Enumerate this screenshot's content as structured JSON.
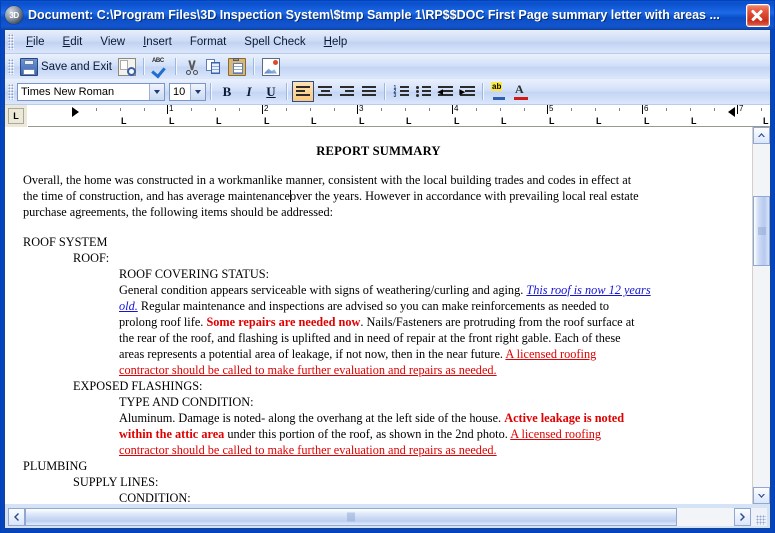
{
  "window": {
    "title": "Document: C:\\Program Files\\3D Inspection System\\$tmp Sample 1\\RP$$DOC First Page summary letter with areas ...",
    "icon": "3d-sphere-icon",
    "close_label": "✕"
  },
  "menubar": {
    "items": [
      {
        "label": "File",
        "accel": "F"
      },
      {
        "label": "Edit",
        "accel": "E"
      },
      {
        "label": "View",
        "accel": "V"
      },
      {
        "label": "Insert",
        "accel": "I"
      },
      {
        "label": "Format",
        "accel": "o"
      },
      {
        "label": "Spell Check",
        "accel": "S"
      },
      {
        "label": "Help",
        "accel": "H"
      }
    ]
  },
  "toolbar": {
    "save_and_exit_label": "Save and Exit",
    "buttons": [
      {
        "name": "save-and-exit",
        "icon": "floppy-disk-icon"
      },
      {
        "name": "print-preview",
        "icon": "print-preview-icon"
      },
      {
        "name": "spell-check",
        "icon": "abc-checkmark-icon"
      },
      {
        "name": "cut",
        "icon": "scissors-icon"
      },
      {
        "name": "copy",
        "icon": "copy-icon"
      },
      {
        "name": "paste",
        "icon": "clipboard-icon"
      },
      {
        "name": "insert-image",
        "icon": "picture-icon"
      }
    ]
  },
  "format_toolbar": {
    "font_name": "Times New Roman",
    "font_size": "10",
    "bold_label": "B",
    "italic_label": "I",
    "underline_label": "U",
    "buttons": [
      {
        "name": "align-left",
        "icon": "align-left-icon",
        "active": true
      },
      {
        "name": "align-center",
        "icon": "align-center-icon",
        "active": false
      },
      {
        "name": "align-right",
        "icon": "align-right-icon",
        "active": false
      },
      {
        "name": "align-justify",
        "icon": "align-justify-icon",
        "active": false
      },
      {
        "name": "numbered-list",
        "icon": "numbered-list-icon",
        "active": false
      },
      {
        "name": "bulleted-list",
        "icon": "bulleted-list-icon",
        "active": false
      },
      {
        "name": "decrease-indent",
        "icon": "decrease-indent-icon",
        "active": false
      },
      {
        "name": "increase-indent",
        "icon": "increase-indent-icon",
        "active": false
      },
      {
        "name": "highlight",
        "icon": "highlight-icon",
        "active": false
      },
      {
        "name": "font-color",
        "icon": "font-color-icon",
        "active": false
      }
    ]
  },
  "ruler": {
    "tab_selector": "L",
    "numbers": [
      "1",
      "2",
      "3",
      "4",
      "5",
      "6",
      "7"
    ],
    "unit": "inches"
  },
  "document": {
    "title": "REPORT SUMMARY",
    "paragraph_1a": "Overall, the home was constructed in a workmanlike manner, consistent with the local building trades and codes in effect at",
    "paragraph_1b": "the time of construction, and has average maintenance",
    "paragraph_1c": "over the years.  However in accordance with  prevailing local real estate",
    "paragraph_1d": "purchase agreements, the following items should be addressed:",
    "heading_roof_system": "ROOF SYSTEM",
    "heading_roof": "ROOF:",
    "heading_roof_covering_status": "ROOF COVERING STATUS:",
    "roof_body_1": "General condition appears serviceable with signs of weathering/curling and aging.",
    "roof_blue_1": "This roof is now 12 years",
    "roof_blue_2": "old.",
    "roof_body_2": "Regular maintenance and inspections are advised so you can make reinforcements as needed to",
    "roof_body_3": "prolong roof life.",
    "roof_red_bold_1": "Some repairs are needed now",
    "roof_body_4": ".    Nails/Fasteners are protruding from the roof surface at",
    "roof_body_5": "the rear of the roof, and flashing is uplifted and in need of repair at the front right gable.  Each of these",
    "roof_body_6": "areas represents a potential area of leakage, if not now, then in the near future.",
    "roof_red_link_1": "A licensed roofing",
    "roof_red_link_2": "contractor should be called to make further evaluation and repairs as needed.",
    "heading_exposed_flashings": "EXPOSED FLASHINGS:",
    "heading_type_and_condition": "TYPE AND CONDITION:",
    "flash_body_1": "Aluminum.  Damage is noted- along the overhang at the left side of the house.",
    "flash_red_bold_1": "Active leakage is noted",
    "flash_red_bold_2": "within the attic area",
    "flash_body_2": "under this portion of the roof, as shown in the 2nd photo.",
    "flash_red_link_1": "A licensed roofing",
    "flash_red_link_2": "contractor should be called to make further evaluation and repairs as needed.",
    "heading_plumbing": "PLUMBING",
    "heading_supply_lines": "SUPPLY LINES:",
    "heading_condition": "CONDITION:"
  },
  "scrollbars": {
    "vertical_up": "▲",
    "vertical_down": "▼",
    "horizontal_left": "❮",
    "horizontal_right": "❯"
  },
  "colors": {
    "title_bar": "#0a56d6",
    "accent_red": "#e00000",
    "accent_blue_link": "#1414d2",
    "toolbar_bg": "#d2e0f8",
    "active_button": "#fbc87a"
  }
}
